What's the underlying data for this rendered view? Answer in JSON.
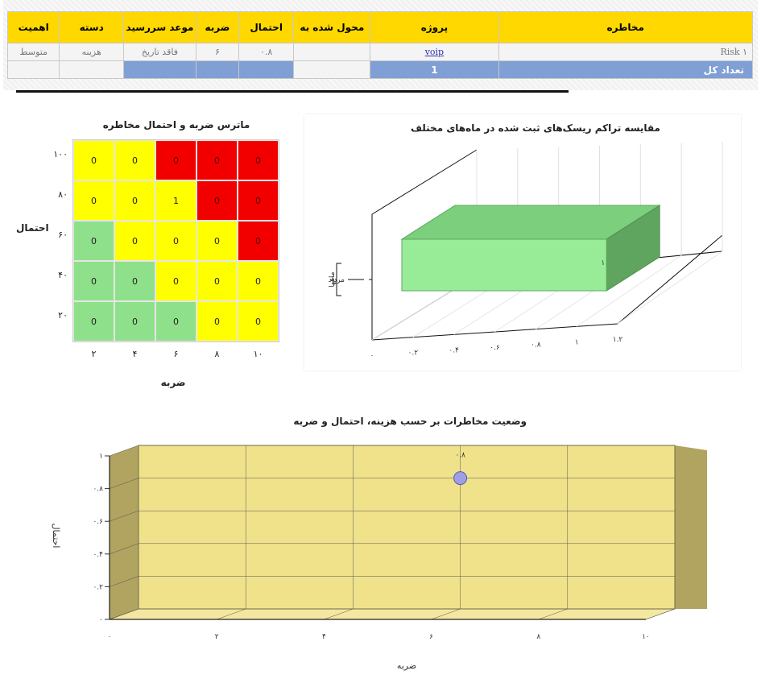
{
  "table": {
    "headers": [
      "مخاطره",
      "پروژه",
      "محول شده به",
      "احتمال",
      "ضربه",
      "موعد سررسید",
      "دسته",
      "اهمیت"
    ],
    "rows": [
      {
        "risk": "Risk ۱",
        "project": "voip",
        "assignee": "",
        "probability": "۰.۸",
        "impact": "۶",
        "due": "فاقد تاریخ",
        "category": "هزینه",
        "importance": "متوسط"
      }
    ],
    "total_label": "تعداد کل",
    "total_value": "1"
  },
  "matrix": {
    "title": "ماترس ضربه و احتمال مخاطره",
    "ylabel": "احتمال",
    "xlabel": "ضربه",
    "row_labels": [
      "۱۰۰",
      "۸۰",
      "۶۰",
      "۴۰",
      "۲۰"
    ],
    "col_labels": [
      "۲",
      "۴",
      "۶",
      "۸",
      "۱۰"
    ],
    "values": [
      [
        0,
        0,
        0,
        0,
        0
      ],
      [
        0,
        0,
        1,
        0,
        0
      ],
      [
        0,
        0,
        0,
        0,
        0
      ],
      [
        0,
        0,
        0,
        0,
        0
      ],
      [
        0,
        0,
        0,
        0,
        0
      ]
    ],
    "colors": [
      [
        "yellow",
        "yellow",
        "red",
        "red",
        "red"
      ],
      [
        "yellow",
        "yellow",
        "yellow",
        "red",
        "red"
      ],
      [
        "green",
        "yellow",
        "yellow",
        "yellow",
        "red"
      ],
      [
        "green",
        "green",
        "yellow",
        "yellow",
        "yellow"
      ],
      [
        "green",
        "green",
        "green",
        "yellow",
        "yellow"
      ]
    ],
    "palette": {
      "red": "#f20000",
      "yellow": "#ffff00",
      "green": "#8fe08a"
    }
  },
  "chart_data": [
    {
      "type": "bar",
      "title": "مقایسه تراکم ریسک‌های ثبت شده در ماه‌های مختلف",
      "orientation": "horizontal",
      "three_d": true,
      "categories": [
        "مرداد"
      ],
      "values": [
        1
      ],
      "value_labels": [
        "۱"
      ],
      "ylabel": "ماهها",
      "xlabel": "",
      "xlim": [
        0,
        1.2
      ],
      "x_ticks": [
        "۰",
        "۰.۲",
        "۰.۴",
        "۰.۶",
        "۰.۸",
        "۱",
        "۱.۲"
      ],
      "color": "#8fe08a",
      "grid": true
    },
    {
      "type": "scatter",
      "title": "وضعیت مخاطرات بر حسب هزینه، احتمال و ضربه",
      "three_d": true,
      "points": [
        {
          "x": 6,
          "y": 0.8,
          "label": "۰.۸"
        }
      ],
      "xlabel": "ضربه",
      "ylabel": "احتمال",
      "xlim": [
        0,
        10
      ],
      "ylim": [
        0,
        1
      ],
      "x_ticks": [
        "۰",
        "۲",
        "۴",
        "۶",
        "۸",
        "۱۰"
      ],
      "y_ticks": [
        "۰",
        "۰.۲",
        "۰.۴",
        "۰.۶",
        "۰.۸",
        "۱"
      ],
      "plot_color": "#f0e28a",
      "marker_color": "#9f9fe6",
      "grid": true
    }
  ]
}
